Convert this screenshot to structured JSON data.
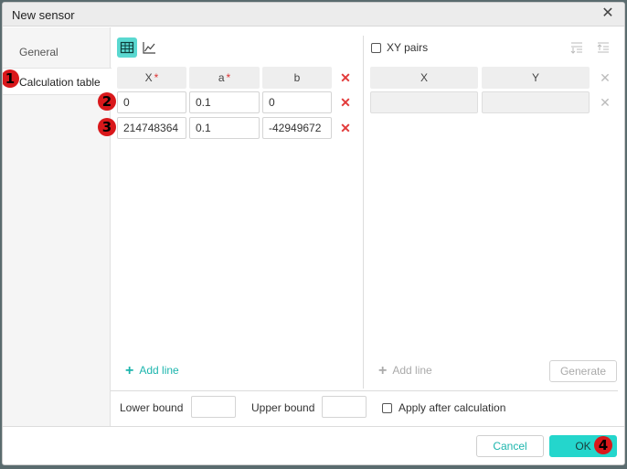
{
  "window": {
    "title": "New sensor"
  },
  "sidebar": {
    "items": [
      {
        "label": "General"
      },
      {
        "label": "Calculation table"
      }
    ]
  },
  "badges": [
    "1",
    "2",
    "3",
    "4"
  ],
  "table": {
    "headers": [
      {
        "label": "X",
        "required": "*"
      },
      {
        "label": "a",
        "required": "*"
      },
      {
        "label": "b"
      }
    ],
    "rows": [
      [
        "0",
        "0.1",
        "0"
      ],
      [
        "214748364",
        "0.1",
        "-42949672"
      ]
    ],
    "add_line": "Add line"
  },
  "xy": {
    "checkbox_label": "XY pairs",
    "headers": [
      "X",
      "Y"
    ],
    "add_line": "Add line",
    "generate": "Generate"
  },
  "bounds": {
    "lower_label": "Lower bound",
    "upper_label": "Upper bound",
    "lower_value": "",
    "upper_value": "",
    "apply_label": "Apply after calculation"
  },
  "footer": {
    "cancel": "Cancel",
    "ok": "OK"
  },
  "colors": {
    "accent": "#24d6cc",
    "danger": "#e23a3a",
    "badge": "#d9181b"
  }
}
